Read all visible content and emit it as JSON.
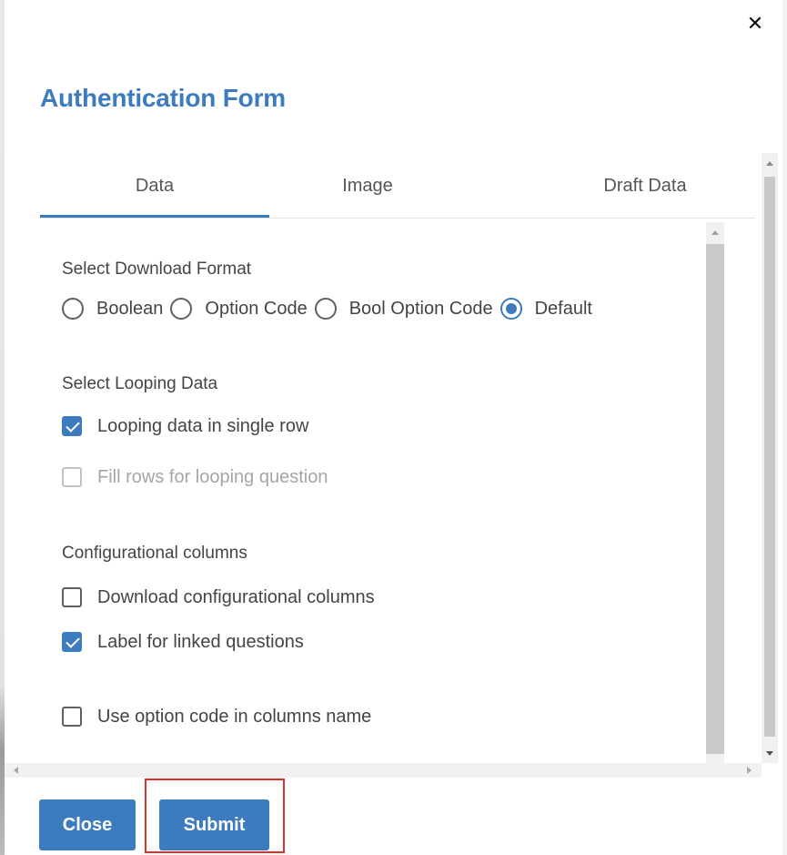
{
  "dialog": {
    "title": "Authentication Form",
    "close_icon": "close-icon"
  },
  "tabs": [
    {
      "label": "Data",
      "active": true
    },
    {
      "label": "Image",
      "active": false
    },
    {
      "label": "Draft Data",
      "active": false
    }
  ],
  "download_format": {
    "label": "Select Download Format",
    "options": [
      {
        "label": "Boolean",
        "checked": false
      },
      {
        "label": "Option Code",
        "checked": false
      },
      {
        "label": "Bool Option Code",
        "checked": false
      },
      {
        "label": "Default",
        "checked": true
      }
    ]
  },
  "looping": {
    "label": "Select Looping Data",
    "options": [
      {
        "label": "Looping data in single row",
        "checked": true,
        "disabled": false
      },
      {
        "label": "Fill rows for looping question",
        "checked": false,
        "disabled": true
      }
    ]
  },
  "config_columns": {
    "label": "Configurational columns",
    "options": [
      {
        "label": "Download configurational columns",
        "checked": false
      },
      {
        "label": "Label for linked questions",
        "checked": true
      }
    ]
  },
  "option_code_columns": {
    "label": "Use option code in columns name",
    "checked": false
  },
  "buttons": {
    "close_label": "Close",
    "submit_label": "Submit"
  },
  "colors": {
    "accent": "#3d7bbf",
    "highlight": "#e23030",
    "disabled_text": "#a5a5a5"
  }
}
